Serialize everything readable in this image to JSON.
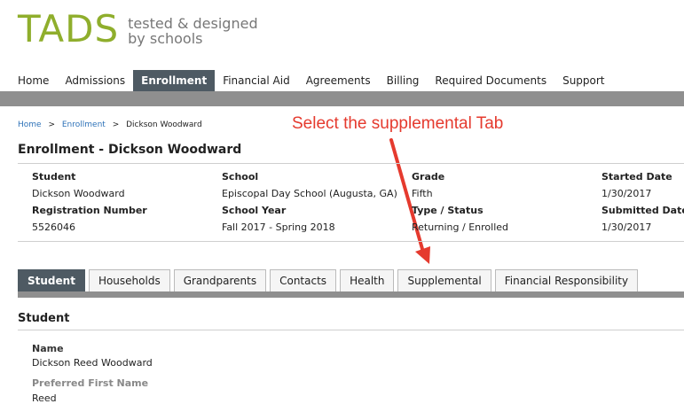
{
  "logo": {
    "mark": "TADS",
    "tagline_line1": "tested & designed",
    "tagline_line2": "by schools"
  },
  "nav": {
    "items": [
      "Home",
      "Admissions",
      "Enrollment",
      "Financial Aid",
      "Agreements",
      "Billing",
      "Required Documents",
      "Support"
    ],
    "active": "Enrollment"
  },
  "breadcrumb": {
    "home": "Home",
    "sep": ">",
    "enrollment": "Enrollment",
    "current": "Dickson Woodward"
  },
  "annotation": {
    "text": "Select the supplemental Tab",
    "color": "#e53a2e"
  },
  "page_title": "Enrollment - Dickson Woodward",
  "info": {
    "student_label": "Student",
    "student_value": "Dickson Woodward",
    "regnum_label": "Registration Number",
    "regnum_value": "5526046",
    "school_label": "School",
    "school_value": "Episcopal Day School (Augusta, GA)",
    "schoolyear_label": "School Year",
    "schoolyear_value": "Fall 2017 - Spring 2018",
    "grade_label": "Grade",
    "grade_value": "Fifth",
    "type_label": "Type / Status",
    "type_value": "Returning / Enrolled",
    "started_label": "Started Date",
    "started_value": "1/30/2017",
    "submitted_label": "Submitted Date",
    "submitted_value": "1/30/2017"
  },
  "tabs": {
    "items": [
      "Student",
      "Households",
      "Grandparents",
      "Contacts",
      "Health",
      "Supplemental",
      "Financial Responsibility"
    ],
    "active": "Student"
  },
  "section": {
    "title": "Student",
    "name_label": "Name",
    "name_value": "Dickson Reed Woodward",
    "preferred_label": "Preferred First Name",
    "preferred_value": "Reed"
  },
  "colors": {
    "brand": "#8fae2c",
    "nav_active": "#4e5a63",
    "bar": "#8f8f8f",
    "link": "#2e72b8"
  }
}
